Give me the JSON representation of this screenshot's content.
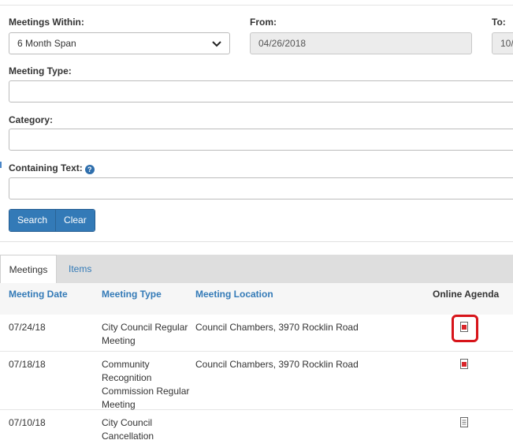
{
  "filters": {
    "meetings_within": {
      "label": "Meetings Within:",
      "value": "6 Month Span"
    },
    "from": {
      "label": "From:",
      "value": "04/26/2018"
    },
    "to": {
      "label": "To:",
      "value": "10/"
    },
    "meeting_type": {
      "label": "Meeting Type:",
      "value": ""
    },
    "category": {
      "label": "Category:",
      "value": ""
    },
    "containing_text": {
      "label": "Containing Text:",
      "value": ""
    }
  },
  "buttons": {
    "search": "Search",
    "clear": "Clear"
  },
  "tabs": [
    {
      "label": "Meetings",
      "active": true
    },
    {
      "label": "Items",
      "active": false
    }
  ],
  "table": {
    "headers": {
      "meeting_date": "Meeting Date",
      "meeting_type": "Meeting Type",
      "meeting_location": "Meeting Location",
      "online_agenda": "Online Agenda"
    },
    "rows": [
      {
        "date": "07/24/18",
        "type": "City Council Regular Meeting",
        "location": "Council Chambers, 3970 Rocklin Road",
        "agenda_icon": "pdf-icon",
        "highlighted": true
      },
      {
        "date": "07/18/18",
        "type": "Community Recognition Commission Regular Meeting",
        "location": "Council Chambers, 3970 Rocklin Road",
        "agenda_icon": "pdf-icon",
        "highlighted": false
      },
      {
        "date": "07/10/18",
        "type": "City Council Cancellation Meeting",
        "location": "",
        "agenda_icon": "document-icon",
        "highlighted": false
      }
    ]
  },
  "colors": {
    "accent": "#337ab7",
    "highlight": "#d7141a",
    "pdf_red": "#d9252a"
  }
}
